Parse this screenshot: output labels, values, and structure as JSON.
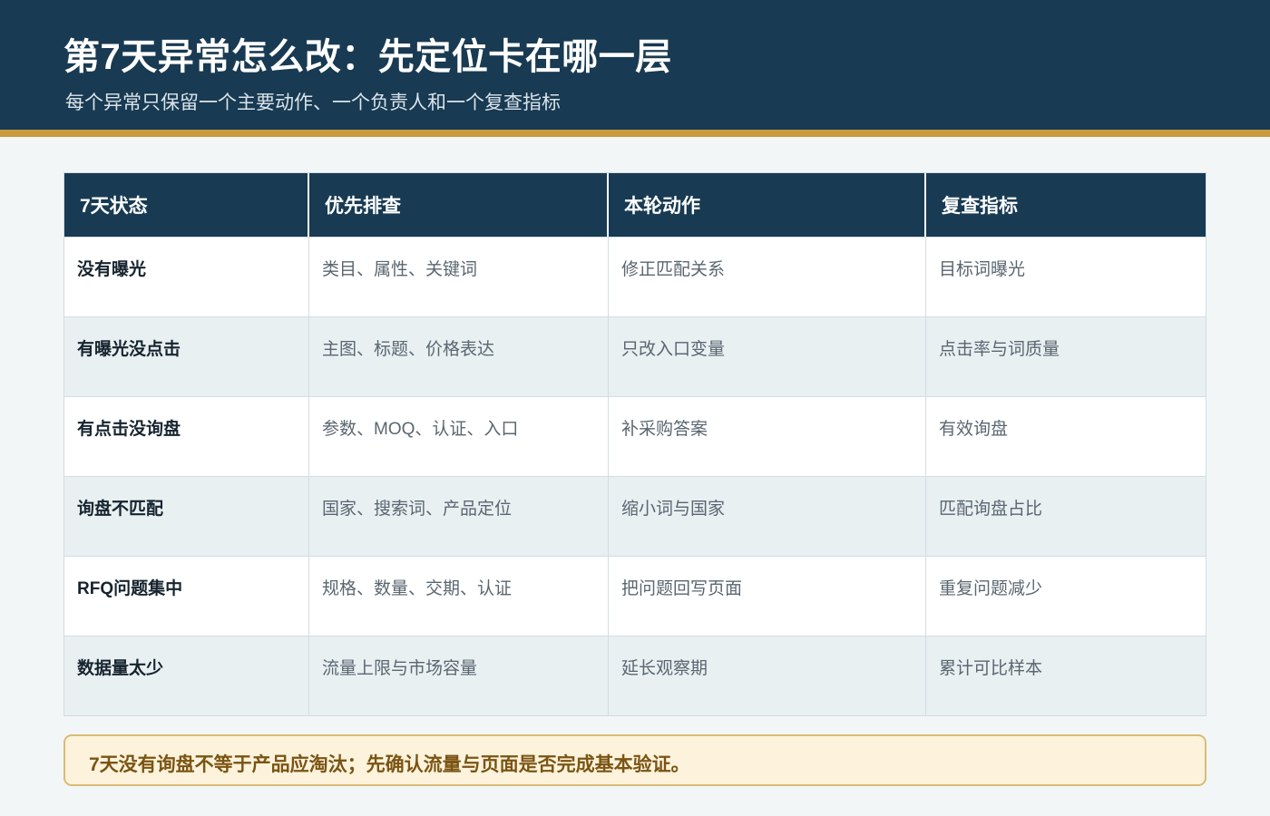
{
  "header": {
    "title": "第7天异常怎么改：先定位卡在哪一层",
    "subtitle": "每个异常只保留一个主要动作、一个负责人和一个复查指标"
  },
  "table": {
    "columns": [
      "7天状态",
      "优先排查",
      "本轮动作",
      "复查指标"
    ],
    "rows": [
      [
        "没有曝光",
        "类目、属性、关键词",
        "修正匹配关系",
        "目标词曝光"
      ],
      [
        "有曝光没点击",
        "主图、标题、价格表达",
        "只改入口变量",
        "点击率与词质量"
      ],
      [
        "有点击没询盘",
        "参数、MOQ、认证、入口",
        "补采购答案",
        "有效询盘"
      ],
      [
        "询盘不匹配",
        "国家、搜索词、产品定位",
        "缩小词与国家",
        "匹配询盘占比"
      ],
      [
        "RFQ问题集中",
        "规格、数量、交期、认证",
        "把问题回写页面",
        "重复问题减少"
      ],
      [
        "数据量太少",
        "流量上限与市场容量",
        "延长观察期",
        "累计可比样本"
      ]
    ]
  },
  "note": {
    "text": "7天没有询盘不等于产品应淘汰；先确认流量与页面是否完成基本验证。"
  },
  "colors": {
    "header_bg": "#183a52",
    "accent_stripe": "#c89b3c",
    "note_bg": "#fdf3dc",
    "note_text": "#7a5413"
  }
}
